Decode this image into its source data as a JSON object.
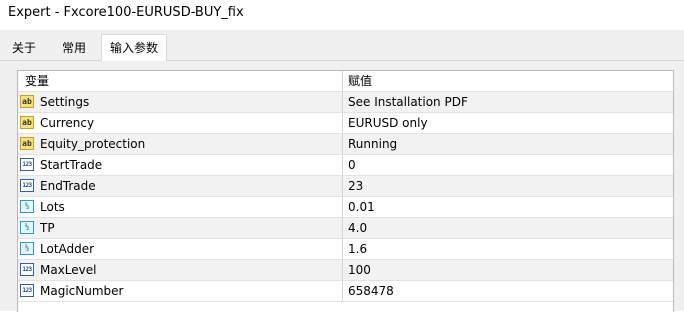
{
  "window": {
    "title": "Expert - Fxcore100-EURUSD-BUY_fix"
  },
  "tabs": [
    {
      "label": "关于"
    },
    {
      "label": "常用"
    },
    {
      "label": "输入参数"
    }
  ],
  "table": {
    "headers": {
      "name": "变量",
      "value": "赋值"
    },
    "rows": [
      {
        "icon": "string-icon",
        "icon_text": "ab",
        "name": "Settings",
        "value": "See Installation PDF"
      },
      {
        "icon": "string-icon",
        "icon_text": "ab",
        "name": "Currency",
        "value": "EURUSD only"
      },
      {
        "icon": "string-icon",
        "icon_text": "ab",
        "name": "Equity_protection",
        "value": "Running"
      },
      {
        "icon": "integer-icon",
        "icon_text": "123",
        "name": "StartTrade",
        "value": "0"
      },
      {
        "icon": "integer-icon",
        "icon_text": "123",
        "name": "EndTrade",
        "value": "23"
      },
      {
        "icon": "double-icon",
        "icon_text": "½",
        "name": "Lots",
        "value": "0.01"
      },
      {
        "icon": "double-icon",
        "icon_text": "½",
        "name": "TP",
        "value": "4.0"
      },
      {
        "icon": "double-icon",
        "icon_text": "½",
        "name": "LotAdder",
        "value": "1.6"
      },
      {
        "icon": "integer-icon",
        "icon_text": "123",
        "name": "MaxLevel",
        "value": "100"
      },
      {
        "icon": "integer-icon",
        "icon_text": "123",
        "name": "MagicNumber",
        "value": "658478"
      }
    ]
  }
}
